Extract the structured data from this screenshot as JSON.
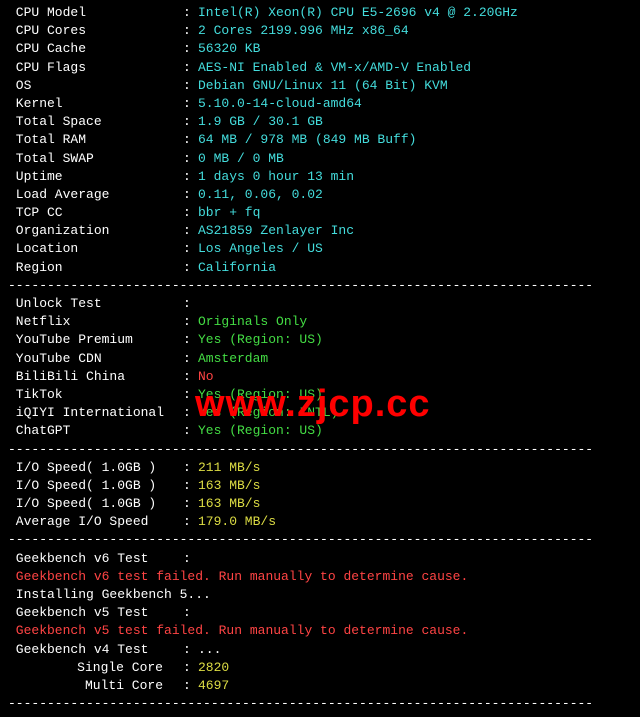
{
  "watermark": "www.zjcp.cc",
  "divider": "---------------------------------------------------------------------------",
  "sys": [
    {
      "label": " CPU Model",
      "value": "Intel(R) Xeon(R) CPU E5-2696 v4 @ 2.20GHz",
      "cls": "val-cyan"
    },
    {
      "label": " CPU Cores",
      "value": "2 Cores 2199.996 MHz x86_64",
      "cls": "val-cyan"
    },
    {
      "label": " CPU Cache",
      "value": "56320 KB",
      "cls": "val-cyan"
    },
    {
      "label": " CPU Flags",
      "value": "AES-NI Enabled & VM-x/AMD-V Enabled",
      "cls": "val-cyan"
    },
    {
      "label": " OS",
      "value": "Debian GNU/Linux 11 (64 Bit) KVM",
      "cls": "val-cyan"
    },
    {
      "label": " Kernel",
      "value": "5.10.0-14-cloud-amd64",
      "cls": "val-cyan"
    },
    {
      "label": " Total Space",
      "value": "1.9 GB / 30.1 GB",
      "cls": "val-cyan"
    },
    {
      "label": " Total RAM",
      "value": "64 MB / 978 MB (849 MB Buff)",
      "cls": "val-cyan"
    },
    {
      "label": " Total SWAP",
      "value": "0 MB / 0 MB",
      "cls": "val-cyan"
    },
    {
      "label": " Uptime",
      "value": "1 days 0 hour 13 min",
      "cls": "val-cyan"
    },
    {
      "label": " Load Average",
      "value": "0.11, 0.06, 0.02",
      "cls": "val-cyan"
    },
    {
      "label": " TCP CC",
      "value": "bbr + fq",
      "cls": "val-cyan"
    },
    {
      "label": " Organization",
      "value": "AS21859 Zenlayer Inc",
      "cls": "val-cyan"
    },
    {
      "label": " Location",
      "value": "Los Angeles / US",
      "cls": "val-cyan"
    },
    {
      "label": " Region",
      "value": "California",
      "cls": "val-cyan"
    }
  ],
  "unlock_header": {
    "label": " Unlock Test",
    "value": ""
  },
  "unlock": [
    {
      "label": " Netflix",
      "value": "Originals Only",
      "cls": "val-green"
    },
    {
      "label": " YouTube Premium",
      "value": "Yes (Region: US)",
      "cls": "val-green"
    },
    {
      "label": " YouTube CDN",
      "value": "Amsterdam",
      "cls": "val-green"
    },
    {
      "label": " BiliBili China",
      "value": "No",
      "cls": "val-red"
    },
    {
      "label": " TikTok",
      "value": "Yes (Region: US)",
      "cls": "val-green"
    },
    {
      "label": " iQIYI International",
      "value": "Yes (Region: INTL)",
      "cls": "val-green"
    },
    {
      "label": " ChatGPT",
      "value": "Yes (Region: US)",
      "cls": "val-green"
    }
  ],
  "io": [
    {
      "label": " I/O Speed( 1.0GB )",
      "value": "211 MB/s",
      "cls": "val-yellow"
    },
    {
      "label": " I/O Speed( 1.0GB )",
      "value": "163 MB/s",
      "cls": "val-yellow"
    },
    {
      "label": " I/O Speed( 1.0GB )",
      "value": "163 MB/s",
      "cls": "val-yellow"
    },
    {
      "label": " Average I/O Speed",
      "value": "179.0 MB/s",
      "cls": "val-yellow"
    }
  ],
  "gb": {
    "v6_label": " Geekbench v6 Test",
    "v6_fail": " Geekbench v6 test failed. Run manually to determine cause.",
    "installing": " Installing Geekbench 5...",
    "v5_label": " Geekbench v5 Test",
    "v5_fail": " Geekbench v5 test failed. Run manually to determine cause.",
    "v4_label": " Geekbench v4 Test",
    "v4_dots": "...",
    "single_label": "Single Core",
    "single_val": "2820",
    "multi_label": "Multi Core",
    "multi_val": "4697"
  }
}
